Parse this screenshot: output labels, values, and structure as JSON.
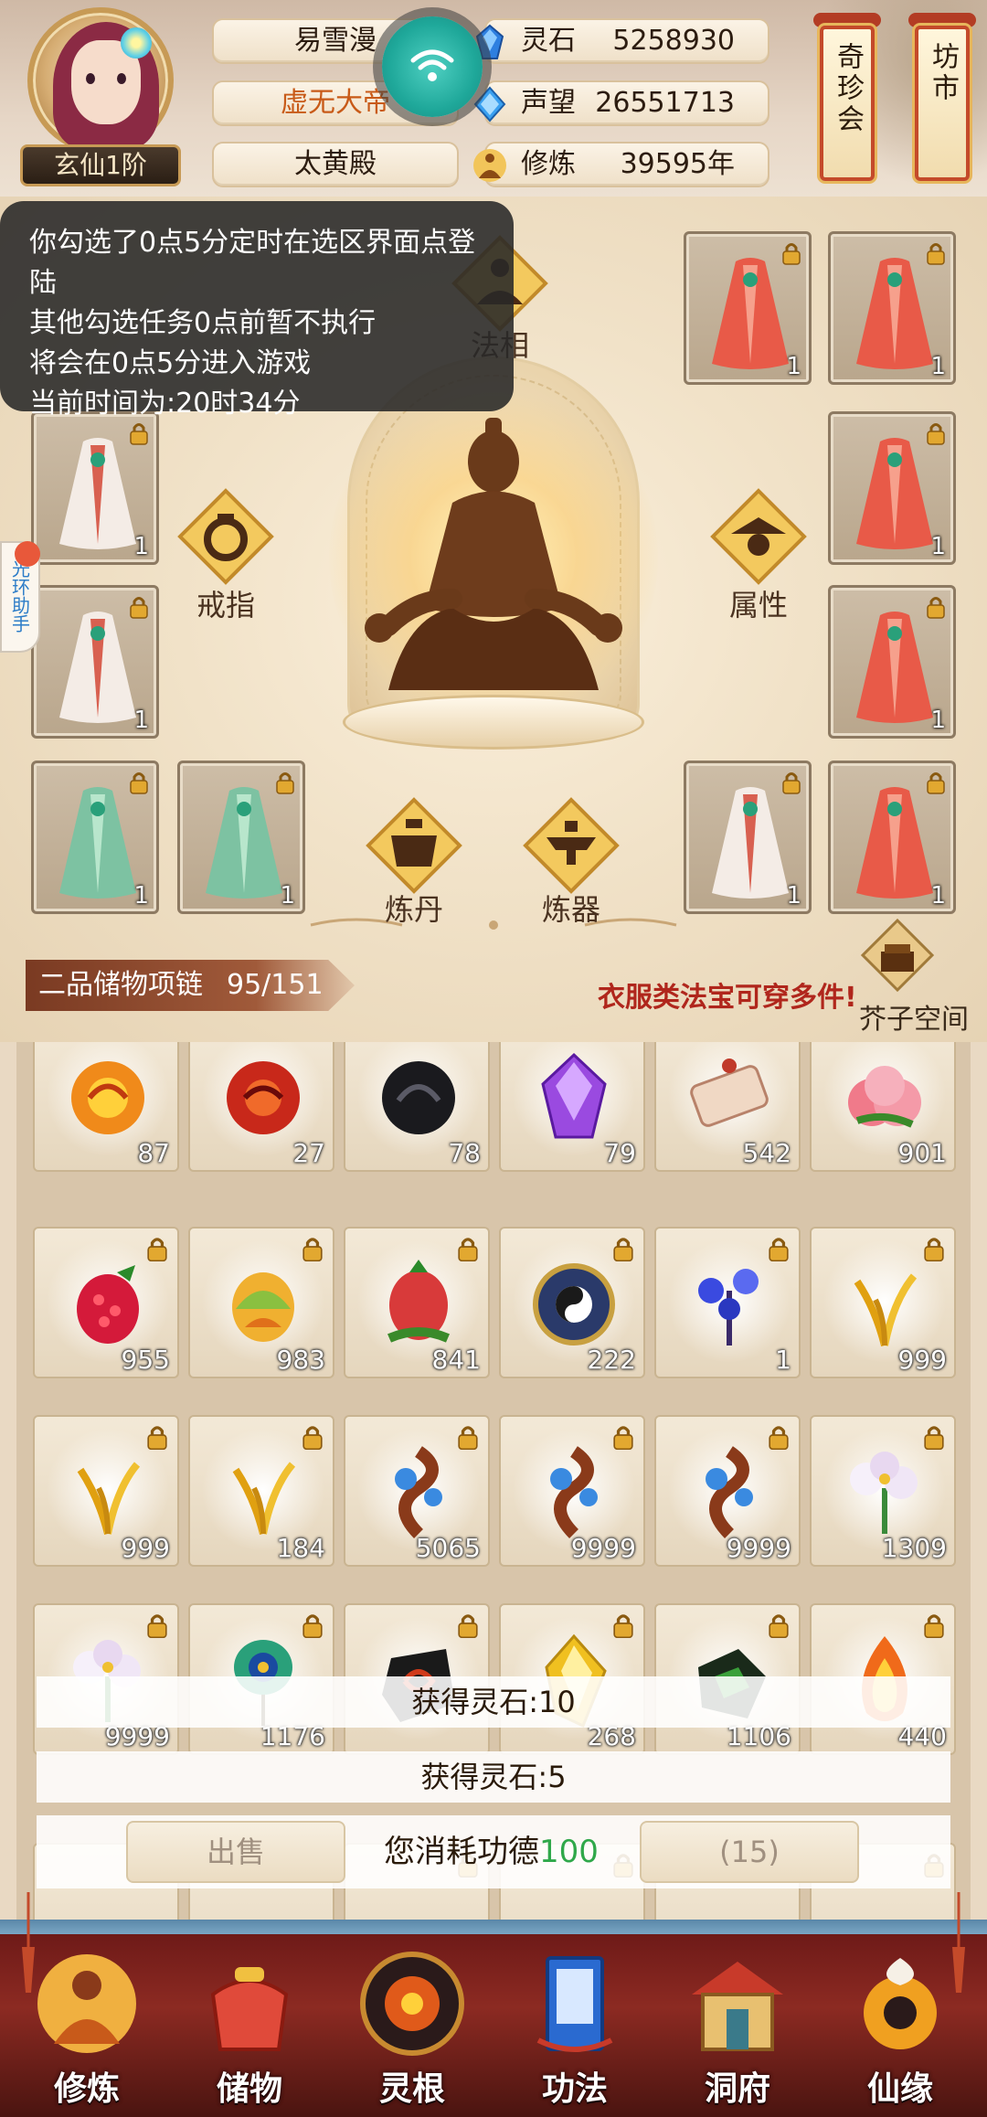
{
  "header": {
    "rank_label": "玄仙1阶",
    "name": "易雪漫",
    "title": "虚无大帝",
    "sect": "太黄殿",
    "resources": [
      {
        "label": "灵石",
        "value": "5258930",
        "icon": "spirit-stone-icon"
      },
      {
        "label": "声望",
        "value": "26551713",
        "icon": "reputation-icon"
      },
      {
        "label": "修炼",
        "value": "39595年",
        "icon": "cultivation-icon"
      }
    ],
    "side_tags": [
      {
        "label": "奇珍会"
      },
      {
        "label": "坊市"
      }
    ]
  },
  "overlay_notice": {
    "lines": [
      "你勾选了0点5分定时在选区界面点登陆",
      "其他勾选任务0点前暂不执行",
      "将会在0点5分进入游戏",
      "当前时间为:20时34分"
    ]
  },
  "side_tab": {
    "label": "光环助手"
  },
  "equip": {
    "function_buttons": [
      {
        "label": "法相"
      },
      {
        "label": "戒指"
      },
      {
        "label": "属性"
      },
      {
        "label": "炼丹"
      },
      {
        "label": "炼器"
      }
    ],
    "slots": [
      {
        "id": "slot-1",
        "qty": "1",
        "robe": "red"
      },
      {
        "id": "slot-2",
        "qty": "1",
        "robe": "red"
      },
      {
        "id": "slot-3",
        "qty": "1",
        "robe": "white"
      },
      {
        "id": "slot-4",
        "qty": "1",
        "robe": "red"
      },
      {
        "id": "slot-5",
        "qty": "1",
        "robe": "white"
      },
      {
        "id": "slot-6",
        "qty": "1",
        "robe": "red"
      },
      {
        "id": "slot-7",
        "qty": "1",
        "robe": "green"
      },
      {
        "id": "slot-8",
        "qty": "1",
        "robe": "green"
      },
      {
        "id": "slot-9",
        "qty": "1",
        "robe": "white"
      },
      {
        "id": "slot-10",
        "qty": "1",
        "robe": "red"
      }
    ],
    "storage_label": "二品储物项链",
    "storage_count": "95/151",
    "hint": "衣服类法宝可穿多件!",
    "jiezi_label": "芥子空间"
  },
  "inventory": {
    "rows": [
      [
        {
          "qty": "87",
          "item": "fire-orb"
        },
        {
          "qty": "27",
          "item": "red-orb"
        },
        {
          "qty": "78",
          "item": "black-orb"
        },
        {
          "qty": "79",
          "item": "purple-crystal"
        },
        {
          "qty": "542",
          "item": "scroll"
        },
        {
          "qty": "901",
          "item": "peach"
        }
      ],
      [
        {
          "qty": "955",
          "item": "raspberry"
        },
        {
          "qty": "983",
          "item": "lotus-fruit"
        },
        {
          "qty": "841",
          "item": "pomegranate"
        },
        {
          "qty": "222",
          "item": "taiji-disc"
        },
        {
          "qty": "1",
          "item": "blue-flower"
        },
        {
          "qty": "999",
          "item": "gold-grass"
        }
      ],
      [
        {
          "qty": "999",
          "item": "gold-grass"
        },
        {
          "qty": "184",
          "item": "gold-grass"
        },
        {
          "qty": "5065",
          "item": "dragon-vine"
        },
        {
          "qty": "9999",
          "item": "dragon-vine"
        },
        {
          "qty": "9999",
          "item": "dragon-vine"
        },
        {
          "qty": "1309",
          "item": "white-lily"
        }
      ],
      [
        {
          "qty": "9999",
          "item": "white-lily"
        },
        {
          "qty": "1176",
          "item": "peacock-feather"
        },
        {
          "qty": "",
          "item": "dark-ore"
        },
        {
          "qty": "268",
          "item": "gold-crystal"
        },
        {
          "qty": "1106",
          "item": "green-ore"
        },
        {
          "qty": "440",
          "item": "flame-crystal"
        }
      ]
    ]
  },
  "toasts": [
    {
      "text": "获得灵石:10"
    },
    {
      "text": "获得灵石:5"
    }
  ],
  "actions": {
    "sell_label": "出售",
    "consume_prefix": "您消耗功德",
    "consume_value": "100",
    "count_label": "(15)"
  },
  "bottom_nav": [
    {
      "label": "修炼",
      "icon": "cultivate-icon"
    },
    {
      "label": "储物",
      "icon": "storage-bag-icon"
    },
    {
      "label": "灵根",
      "icon": "spirit-root-icon"
    },
    {
      "label": "功法",
      "icon": "technique-book-icon"
    },
    {
      "label": "洞府",
      "icon": "cave-dwelling-icon"
    },
    {
      "label": "仙缘",
      "icon": "immortal-fate-icon"
    }
  ],
  "colors": {
    "accent_red": "#b0261c",
    "consume_green": "#2fa84a",
    "nav_bg": "#8c2a22"
  }
}
